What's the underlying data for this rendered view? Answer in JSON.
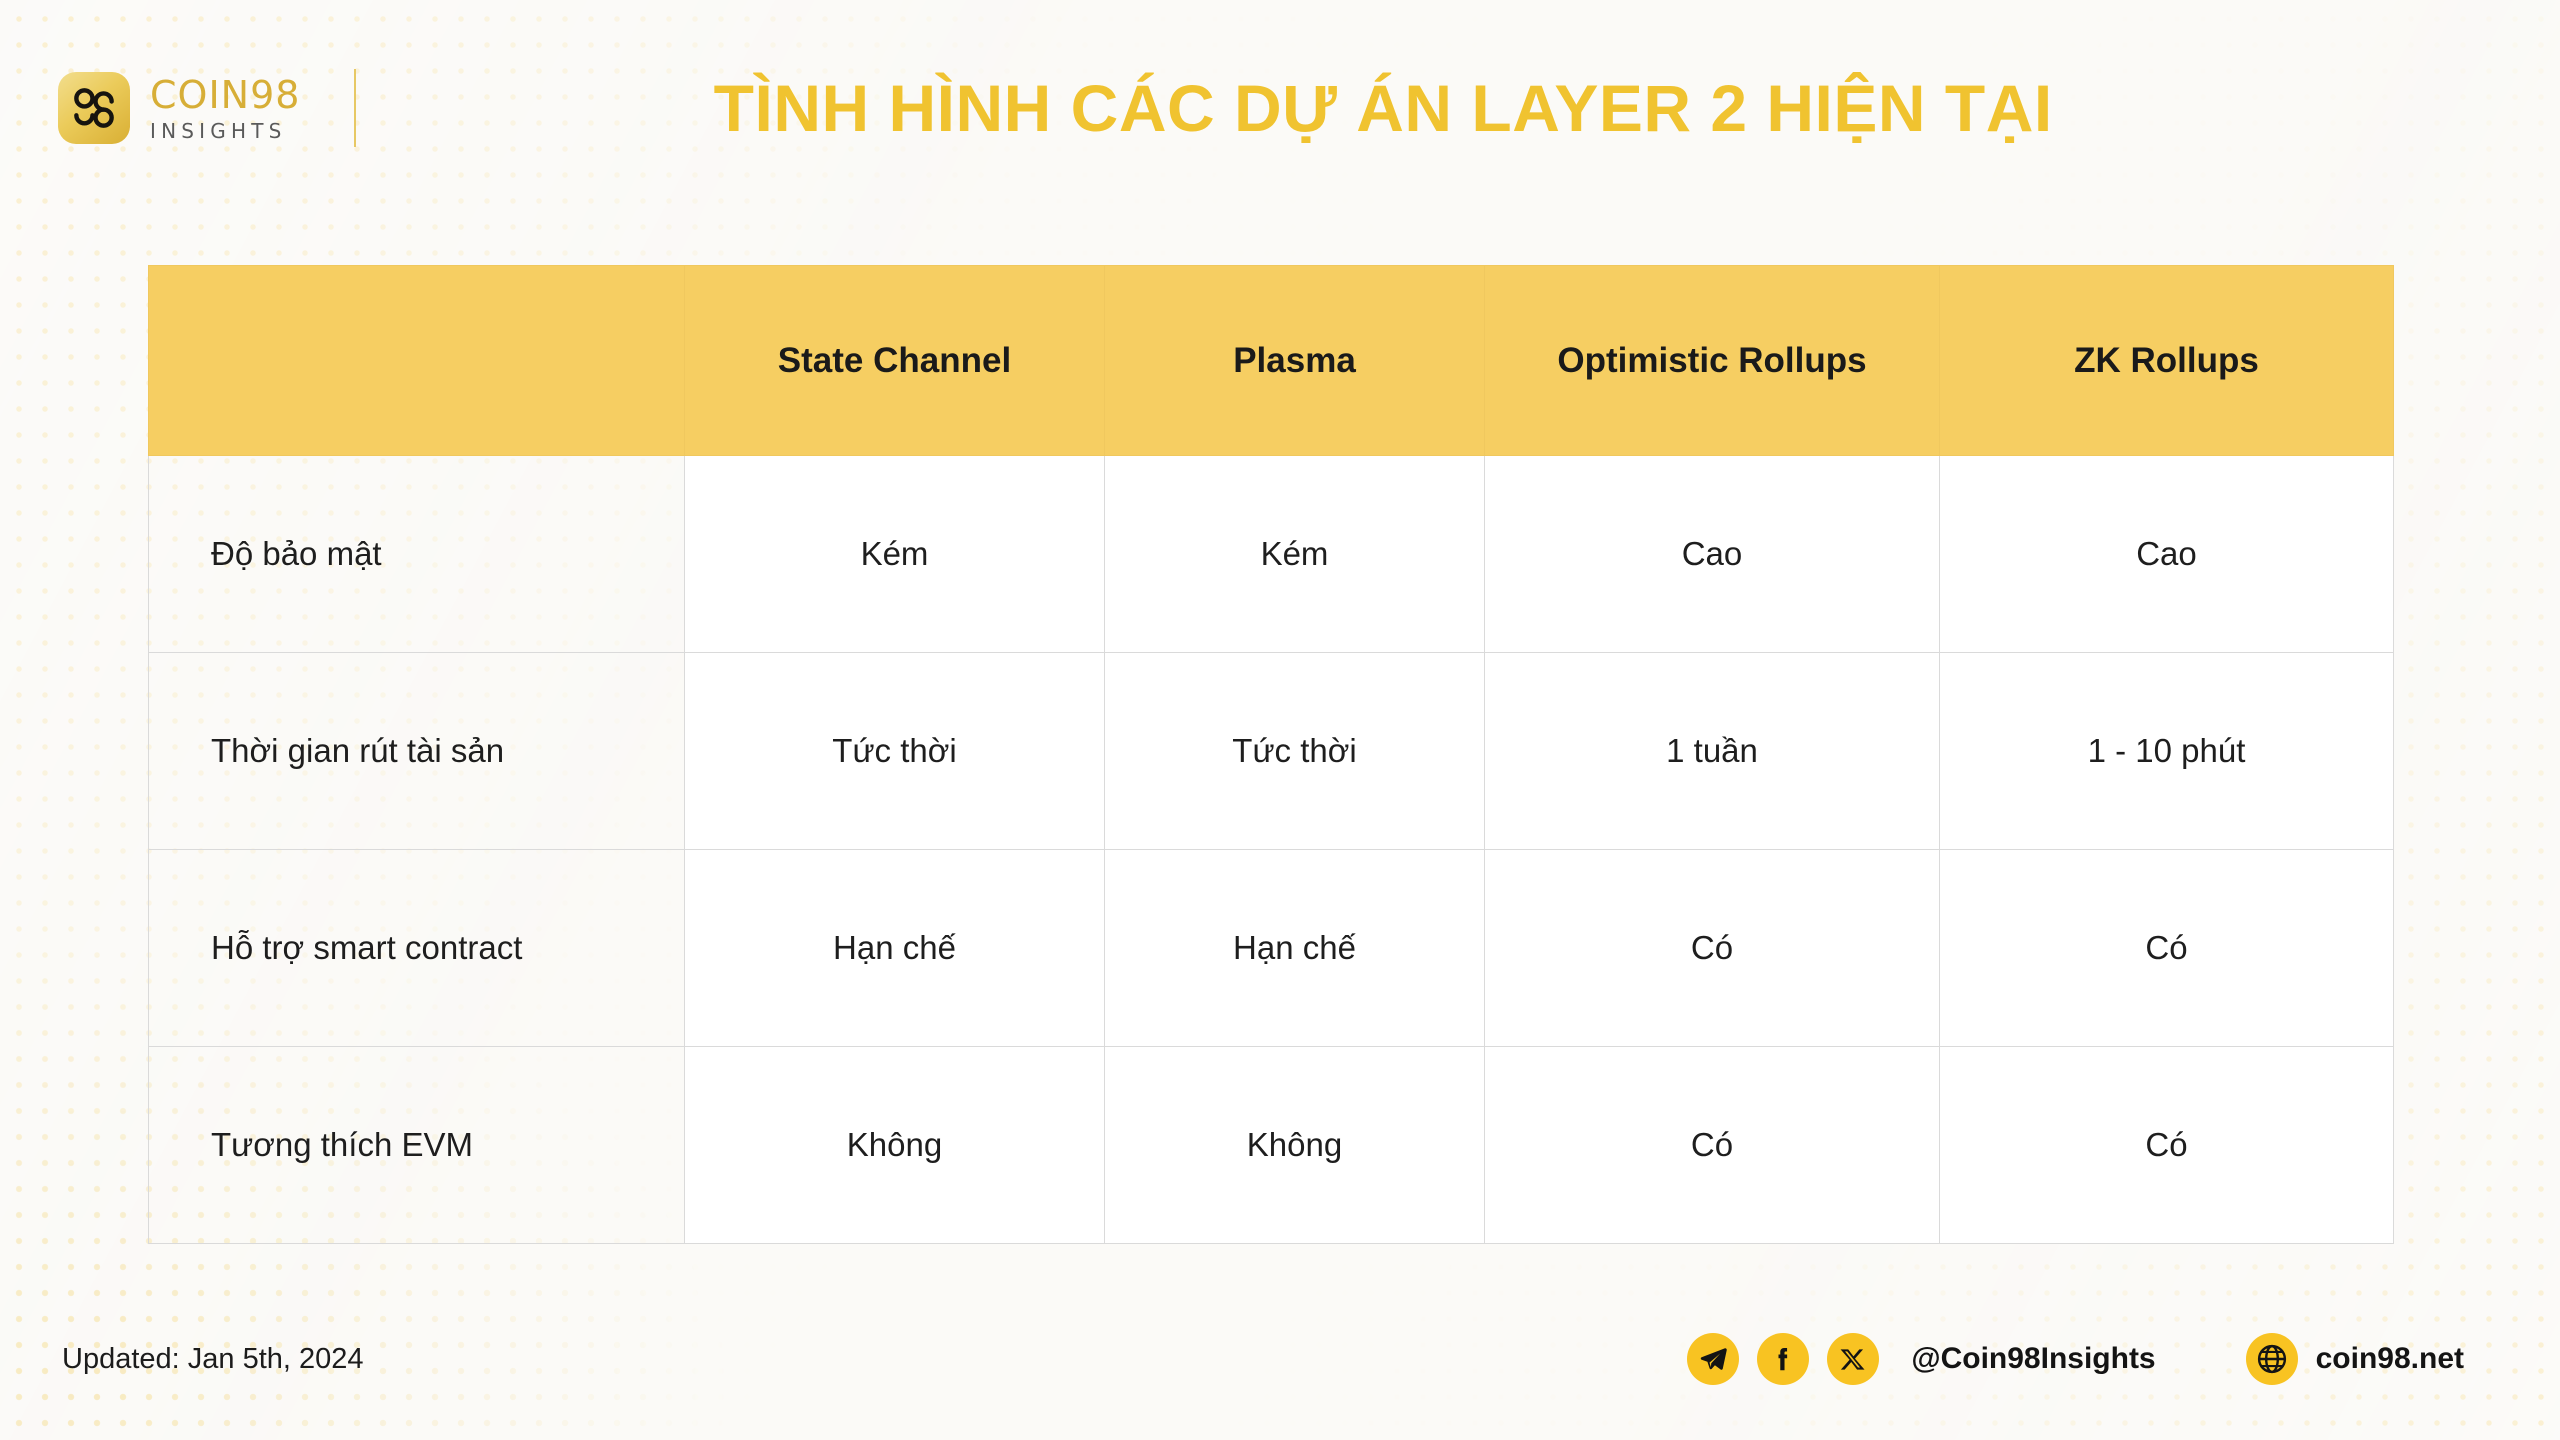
{
  "brand": {
    "logo_icon": "coin98-logo-icon",
    "name": "COIN98",
    "sub": "INSIGHTS"
  },
  "header": {
    "title": "TÌNH HÌNH CÁC DỰ ÁN LAYER 2 HIỆN TẠI",
    "title_color": "#F0C330"
  },
  "table": {
    "header_bg": "#F6CE62",
    "columns": [
      "",
      "State Channel",
      "Plasma",
      "Optimistic Rollups",
      "ZK Rollups"
    ],
    "rows": [
      {
        "label": "Độ bảo mật",
        "cells": [
          "Kém",
          "Kém",
          "Cao",
          "Cao"
        ]
      },
      {
        "label": "Thời gian rút tài sản",
        "cells": [
          "Tức thời",
          "Tức thời",
          "1 tuần",
          "1 - 10 phút"
        ]
      },
      {
        "label": "Hỗ trợ smart contract",
        "cells": [
          "Hạn chế",
          "Hạn chế",
          "Có",
          "Có"
        ]
      },
      {
        "label": "Tương thích EVM",
        "cells": [
          "Không",
          "Không",
          "Có",
          "Có"
        ]
      }
    ]
  },
  "footer": {
    "updated": "Updated: Jan 5th, 2024",
    "social_icons": [
      "telegram-icon",
      "facebook-icon",
      "x-twitter-icon"
    ],
    "handle": "@Coin98Insights",
    "website_icon": "globe-icon",
    "website": "coin98.net",
    "badge_color": "#F8C322"
  }
}
